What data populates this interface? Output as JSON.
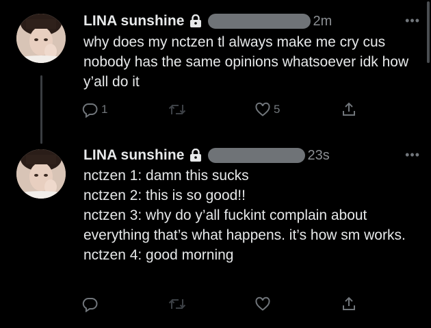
{
  "tweets": [
    {
      "author": "LINA sunshine",
      "time": "2m",
      "more": "•••",
      "text": "why does my nctzen tl always make me cry cus nobody has the same opinions whatsoever idk how y’all do it",
      "reply_count": "1",
      "retweet_count": "",
      "like_count": "5"
    },
    {
      "author": "LINA sunshine",
      "time": "23s",
      "more": "•••",
      "text": "nctzen 1: damn this sucks\nnctzen 2: this is so good!!\nnctzen 3: why do y’all fuckint complain about everything that’s what happens. it’s how sm works.\nnctzen 4: good morning",
      "reply_count": "",
      "retweet_count": "",
      "like_count": ""
    }
  ],
  "icons": {
    "lock": "lock-icon",
    "reply": "reply-icon",
    "retweet": "retweet-icon",
    "like": "heart-icon",
    "share": "share-icon"
  },
  "colors": {
    "background": "#000000",
    "text": "#e7e9ea",
    "muted": "#71767b"
  }
}
